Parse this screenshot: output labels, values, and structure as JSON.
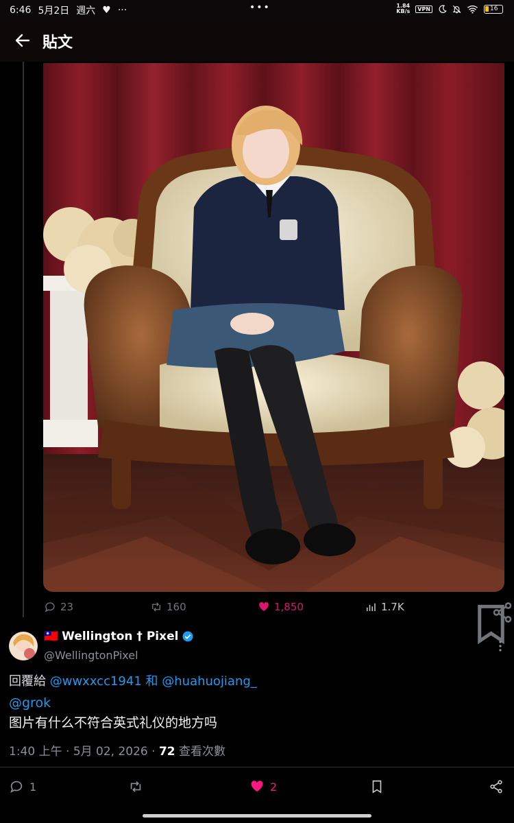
{
  "status_bar": {
    "time": "6:46",
    "date": "5月2日",
    "weekday": "週六",
    "more_dots": "···",
    "center_dots": "•••",
    "net_speed_value": "1.84",
    "net_speed_unit": "KB/s",
    "vpn": "VPN",
    "battery": "16"
  },
  "header": {
    "title": "貼文"
  },
  "post": {
    "image_alt": "Cosplayer in navy school sweater and pleated skirt sitting on ornate cream armchair before a red curtain",
    "replies": "23",
    "reposts": "160",
    "likes": "1,850",
    "views": "1.7K",
    "like_color": "#f91880"
  },
  "reply": {
    "flag": "🇹🇼",
    "display_name": "Wellington † Pixel",
    "handle": "@WellingtonPixel",
    "reply_prefix": "回覆給",
    "reply_user1": "@wwxxcc1941",
    "reply_and": "和",
    "reply_user2": "@huahuojiang_",
    "mention": "@grok",
    "text": "图片有什么不符合英式礼仪的地方吗",
    "time": "1:40 上午",
    "sep": "·",
    "date": "5月 02, 2026",
    "views_count": "72",
    "views_label": "查看次數",
    "reply_count": "1",
    "like_count": "2",
    "accent_color": "#1d9bf0"
  }
}
